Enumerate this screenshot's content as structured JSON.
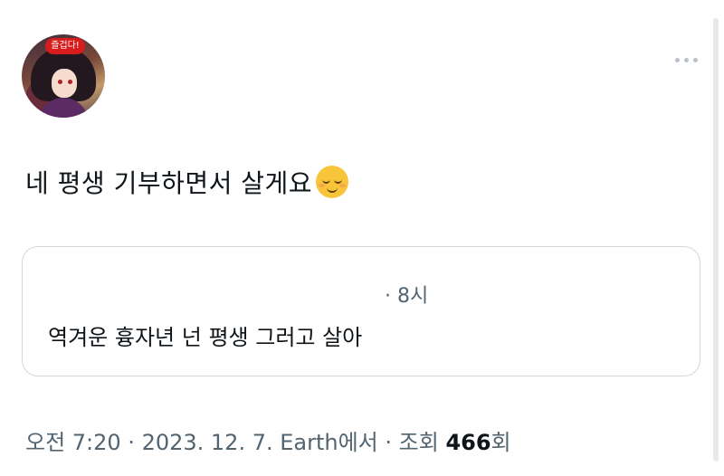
{
  "avatar": {
    "badge_text": "즐겁다!"
  },
  "tweet": {
    "text": "네 평생 기부하면서 살게요",
    "emoji": "relieved-face"
  },
  "quoted": {
    "time": "· 8시",
    "text": "역겨운 흉자년 넌 평생 그러고 살아"
  },
  "meta": {
    "timestamp": "오전 7:20 · 2023. 12. 7. Earth에서 · 조회 ",
    "views_count": "466",
    "views_suffix": "회"
  },
  "colors": {
    "secondary_text": "#536471",
    "border": "#cfd9de",
    "badge": "#d81b1b"
  }
}
